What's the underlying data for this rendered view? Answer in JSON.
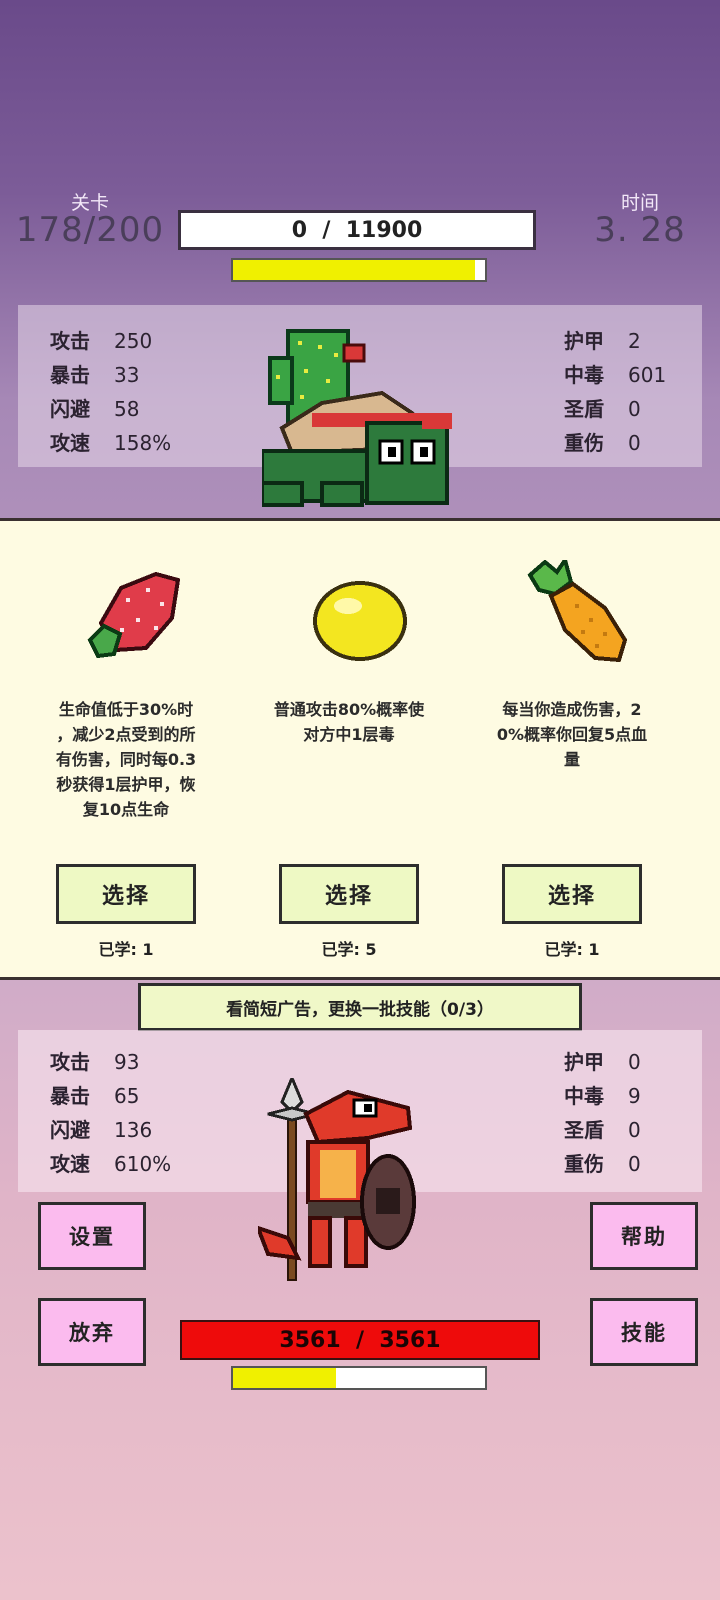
{
  "header": {
    "level_label": "关卡",
    "level_value": "178/200",
    "time_label": "时间",
    "time_value": "3. 28",
    "enemy_hp_text": "0  /  11900",
    "enemy_energy_fraction": 0.96
  },
  "enemy_stats": {
    "left": [
      {
        "k": "攻击",
        "v": "250"
      },
      {
        "k": "暴击",
        "v": "33"
      },
      {
        "k": "闪避",
        "v": "58"
      },
      {
        "k": "攻速",
        "v": "158%"
      }
    ],
    "right": [
      {
        "k": "护甲",
        "v": "2"
      },
      {
        "k": "中毒",
        "v": "601"
      },
      {
        "k": "圣盾",
        "v": "0"
      },
      {
        "k": "重伤",
        "v": "0"
      }
    ]
  },
  "skills": [
    {
      "icon": "strawberry-icon",
      "desc": [
        "生命值低于30%时",
        "，减少2点受到的所",
        "有伤害，同时每0.3",
        "秒获得1层护甲，恢",
        "复10点生命"
      ],
      "button": "选择",
      "learned": "已学: 1"
    },
    {
      "icon": "lemon-icon",
      "desc": [
        "普通攻击80%概率使",
        "对方中1层毒"
      ],
      "button": "选择",
      "learned": "已学: 5"
    },
    {
      "icon": "pineapple-icon",
      "desc": [
        "每当你造成伤害，2",
        "0%概率你回复5点血",
        "量"
      ],
      "button": "选择",
      "learned": "已学: 1"
    }
  ],
  "reroll_button": "看简短广告，更换一批技能（0/3）",
  "player_stats": {
    "left": [
      {
        "k": "攻击",
        "v": "93"
      },
      {
        "k": "暴击",
        "v": "65"
      },
      {
        "k": "闪避",
        "v": "136"
      },
      {
        "k": "攻速",
        "v": "610%"
      }
    ],
    "right": [
      {
        "k": "护甲",
        "v": "0"
      },
      {
        "k": "中毒",
        "v": "9"
      },
      {
        "k": "圣盾",
        "v": "0"
      },
      {
        "k": "重伤",
        "v": "0"
      }
    ]
  },
  "buttons": {
    "settings": "设置",
    "help": "帮助",
    "give_up": "放弃",
    "skills": "技能"
  },
  "player_hp_text": "3561  /  3561",
  "player_energy_fraction": 0.41,
  "colors": {
    "enemy_energy": "#f0f000",
    "player_hp": "#ee0b0b",
    "player_energy": "#f0f000"
  }
}
